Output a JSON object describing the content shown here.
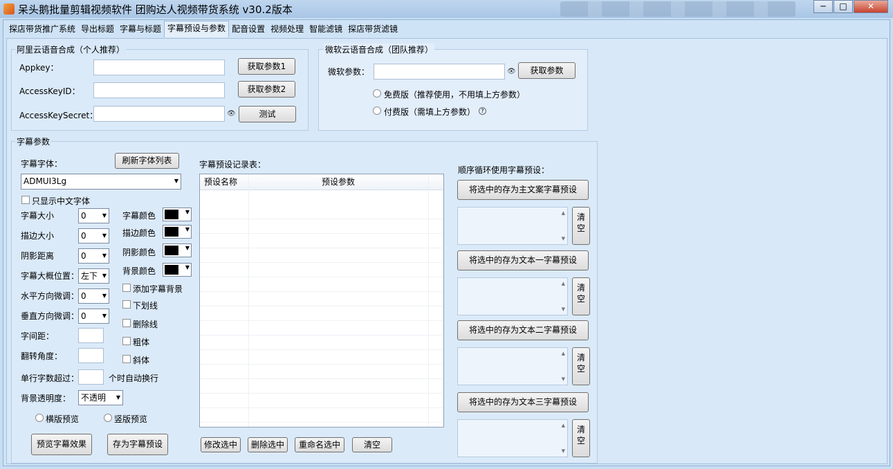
{
  "window": {
    "title": "呆头鹅批量剪辑视频软件   团购达人视频带货系统  v30.2版本",
    "min": "─",
    "max": "□",
    "close": "✕"
  },
  "tabs": [
    "探店带货推广系统",
    "导出标题",
    "字幕与标题",
    "字幕预设与参数",
    "配音设置",
    "视频处理",
    "智能滤镜",
    "探店带货滤镜"
  ],
  "aliyun": {
    "legend": "阿里云语音合成（个人推荐）",
    "appkey_label": "Appkey：",
    "accesskeyid_label": "AccessKeyID：",
    "accesskeysecret_label": "AccessKeySecret：",
    "btn1": "获取参数1",
    "btn2": "获取参数2",
    "test": "测试"
  },
  "microsoft": {
    "legend": "微软云语音合成（团队推荐）",
    "param_label": "微软参数：",
    "btn": "获取参数",
    "free": "免费版（推荐使用，不用填上方参数）",
    "paid": "付费版（需填上方参数）",
    "help": "?"
  },
  "subtitle": {
    "legend": "字幕参数",
    "font_label": "字幕字体：",
    "refresh_fonts": "刷新字体列表",
    "font_value": "ADMUI3Lg",
    "only_chinese": "只显示中文字体",
    "size_label": "字幕大小",
    "stroke_label": "描边大小",
    "shadow_label": "阴影距离",
    "position_label": "字幕大概位置：",
    "h_adjust_label": "水平方向微调：",
    "v_adjust_label": "垂直方向微调：",
    "spacing_label": "字间距：",
    "rotate_label": "翻转角度：",
    "wrap_label": "单行字数超过：",
    "wrap_suffix": "个时自动换行",
    "opacity_label": "背景透明度：",
    "opacity_value": "不透明",
    "size_value": "0",
    "stroke_value": "0",
    "shadow_value": "0",
    "position_value": "左下",
    "h_value": "0",
    "v_value": "0",
    "color_label": "字幕颜色",
    "stroke_color_label": "描边颜色",
    "shadow_color_label": "阴影颜色",
    "bg_color_label": "背景颜色",
    "add_bg": "添加字幕背景",
    "underline": "下划线",
    "strike": "删除线",
    "bold": "粗体",
    "italic": "斜体",
    "landscape": "横版预览",
    "portrait": "竖版预览",
    "preview_btn": "预览字幕效果",
    "save_btn": "存为字幕预设"
  },
  "presets": {
    "label": "字幕预设记录表：",
    "col_name": "预设名称",
    "col_params": "预设参数",
    "modify": "修改选中",
    "delete": "删除选中",
    "rename": "重命名选中",
    "clear": "清空"
  },
  "cycle": {
    "label": "顺序循环使用字幕预设：",
    "save_main": "将选中的存为主文案字幕预设",
    "save_text1": "将选中的存为文本一字幕预设",
    "save_text2": "将选中的存为文本二字幕预设",
    "save_text3": "将选中的存为文本三字幕预设",
    "clear_top": "清",
    "clear_bottom": "空"
  },
  "colors": {
    "bg": "#d8e8f8",
    "title": "#a9c6e6"
  }
}
